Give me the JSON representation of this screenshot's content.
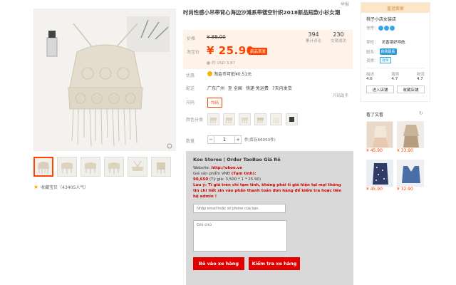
{
  "header": {
    "report": "举报"
  },
  "product": {
    "title": "时尚性感小吊带背心海边沙滩系带镂空针织2018新品短款小衫女潮",
    "favorite_label": "收藏宝贝（43405人气）"
  },
  "price": {
    "label_original": "价格",
    "original": "¥ 89.00",
    "label_sale": "淘宝价",
    "sale": "¥ 25.90",
    "sale_badge": "新品首发",
    "usd": "约 USD 3.87",
    "stats": [
      {
        "value": "394",
        "label": "累计评论"
      },
      {
        "value": "230",
        "label": "交易成功"
      }
    ]
  },
  "promo": {
    "label": "优惠",
    "text": "淘金币可抵¥0.51元"
  },
  "delivery": {
    "label": "配送",
    "origin": "广东广州",
    "to": "至 全国",
    "express": "快递 免运费",
    "return": "7天内发货"
  },
  "size": {
    "label": "尺码",
    "option": "均码",
    "guide": "尺码助手"
  },
  "color": {
    "label": "颜色分类"
  },
  "quantity": {
    "label": "数量",
    "value": "1",
    "minus": "−",
    "plus": "+",
    "stock": "件(库存66053件)"
  },
  "order": {
    "header": "Koo Storee | Order TaoBao Giá Rẻ",
    "website_label": "Website: ",
    "website": "http://okoo.vn",
    "price_label": "Giá sản phẩm VNĐ ",
    "price_note": "(Tạm tính):",
    "price_value": "90,650",
    "rate_note": " (Tỷ giá: 3,500 * 1 * 25.90)",
    "warning": "Lưu ý: Tỉ giá trên chỉ tạm tính, không phải tỉ giá hiện tại mọi thông tin chi tiết xin vào phần thanh toán đơn hàng để kiểm tra hoặc liên hệ admin !",
    "email_placeholder": "Nhập email hoặc số phone của bạn",
    "note_placeholder": "Ghi chú",
    "add_button": "Bỏ vào xe hàng",
    "check_button": "Kiểm tra xe hàng"
  },
  "shop": {
    "header": "皇冠卖家",
    "name": "桃子小店女装店",
    "credit_label": "信誉：",
    "master_label": "掌柜：",
    "master": "灵香镜好呼航",
    "contact_label": "联系：",
    "contact_badge": "和我联系",
    "qual_label": "资质：",
    "qual_badge": "消保",
    "scores": [
      {
        "k": "描述",
        "v": "4.6"
      },
      {
        "k": "服务",
        "v": "4.7"
      },
      {
        "k": "物流",
        "v": "4.7"
      }
    ],
    "enter_button": "进入店铺",
    "fav_button": "收藏店铺"
  },
  "seen": {
    "title": "看了又看",
    "items": [
      {
        "price": "¥ 45.90"
      },
      {
        "price": "¥ 33.90"
      },
      {
        "price": "¥ 45.90"
      },
      {
        "price": "¥ 32.90"
      }
    ]
  },
  "colors": {
    "accent": "#ff4400",
    "price_bg": "#fff2e8",
    "order_bg": "#d9d9d9",
    "order_btn": "#e00000"
  }
}
